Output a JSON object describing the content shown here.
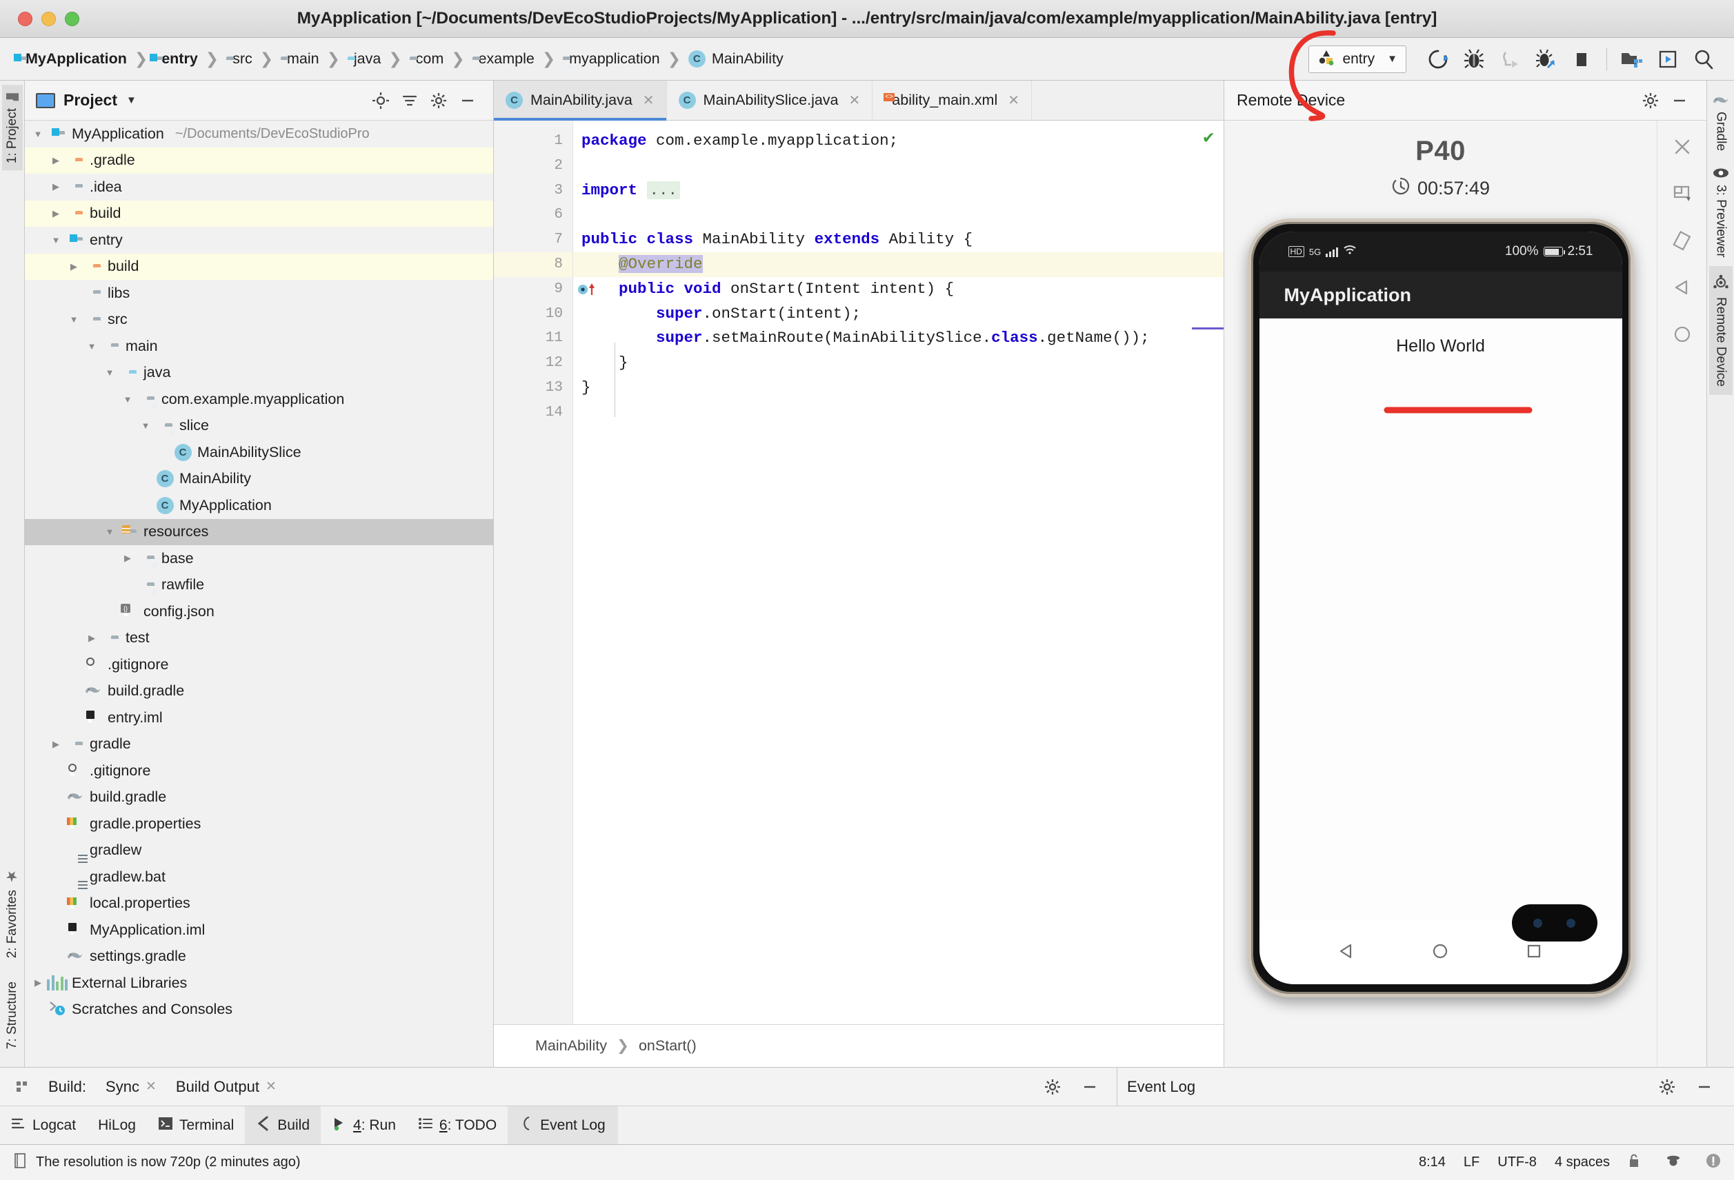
{
  "window": {
    "title": "MyApplication [~/Documents/DevEcoStudioProjects/MyApplication] - .../entry/src/main/java/com/example/myapplication/MainAbility.java [entry]"
  },
  "breadcrumbs": [
    {
      "label": "MyApplication",
      "icon": "module-folder-icon",
      "bold": true
    },
    {
      "label": "entry",
      "icon": "module-folder-icon",
      "bold": true
    },
    {
      "label": "src",
      "icon": "folder-icon",
      "bold": false
    },
    {
      "label": "main",
      "icon": "folder-icon",
      "bold": false
    },
    {
      "label": "java",
      "icon": "source-folder-icon",
      "bold": false
    },
    {
      "label": "com",
      "icon": "package-folder-icon",
      "bold": false
    },
    {
      "label": "example",
      "icon": "package-folder-icon",
      "bold": false
    },
    {
      "label": "myapplication",
      "icon": "package-folder-icon",
      "bold": false
    },
    {
      "label": "MainAbility",
      "icon": "java-class-icon",
      "bold": false
    }
  ],
  "toolbar": {
    "run_config_label": "entry",
    "buttons": [
      {
        "name": "rerun-button",
        "title": "Rerun"
      },
      {
        "name": "debug-button",
        "title": "Debug"
      },
      {
        "name": "attach-debugger-button",
        "title": "Attach Debugger"
      },
      {
        "name": "debug-ohos-button",
        "title": "Debug OHOS"
      },
      {
        "name": "stop-button",
        "title": "Stop"
      },
      {
        "name": "project-structure-button",
        "title": "Project Structure"
      },
      {
        "name": "previewer-button",
        "title": "Previewer"
      },
      {
        "name": "search-everywhere-button",
        "title": "Search Everywhere"
      }
    ]
  },
  "left_strip": {
    "top": "1: Project",
    "favorites": "2: Favorites",
    "structure": "7: Structure"
  },
  "project_panel": {
    "title": "Project",
    "tree": [
      {
        "label": "MyApplication",
        "sub": "~/Documents/DevEcoStudioPro",
        "depth": 0,
        "arrow": "down",
        "icon": "module-folder-icon",
        "style": "sel-root"
      },
      {
        "label": ".gradle",
        "sub": "",
        "depth": 1,
        "arrow": "right",
        "icon": "orange-folder-icon",
        "style": "yellow"
      },
      {
        "label": ".idea",
        "sub": "",
        "depth": 1,
        "arrow": "right",
        "icon": "folder-icon",
        "style": ""
      },
      {
        "label": "build",
        "sub": "",
        "depth": 1,
        "arrow": "right",
        "icon": "orange-folder-icon",
        "style": "yellow"
      },
      {
        "label": "entry",
        "sub": "",
        "depth": 1,
        "arrow": "down",
        "icon": "module-folder-icon",
        "style": ""
      },
      {
        "label": "build",
        "sub": "",
        "depth": 2,
        "arrow": "right",
        "icon": "orange-folder-icon",
        "style": "yellow"
      },
      {
        "label": "libs",
        "sub": "",
        "depth": 2,
        "arrow": "none",
        "icon": "folder-icon",
        "style": ""
      },
      {
        "label": "src",
        "sub": "",
        "depth": 2,
        "arrow": "down",
        "icon": "folder-icon",
        "style": ""
      },
      {
        "label": "main",
        "sub": "",
        "depth": 3,
        "arrow": "down",
        "icon": "folder-icon",
        "style": ""
      },
      {
        "label": "java",
        "sub": "",
        "depth": 4,
        "arrow": "down",
        "icon": "source-folder-icon",
        "style": ""
      },
      {
        "label": "com.example.myapplication",
        "sub": "",
        "depth": 5,
        "arrow": "down",
        "icon": "package-folder-icon",
        "style": ""
      },
      {
        "label": "slice",
        "sub": "",
        "depth": 6,
        "arrow": "down",
        "icon": "package-folder-icon",
        "style": ""
      },
      {
        "label": "MainAbilitySlice",
        "sub": "",
        "depth": 7,
        "arrow": "none",
        "icon": "java-class-icon",
        "style": ""
      },
      {
        "label": "MainAbility",
        "sub": "",
        "depth": 6,
        "arrow": "none",
        "icon": "java-class-icon",
        "style": ""
      },
      {
        "label": "MyApplication",
        "sub": "",
        "depth": 6,
        "arrow": "none",
        "icon": "java-class-icon",
        "style": ""
      },
      {
        "label": "resources",
        "sub": "",
        "depth": 4,
        "arrow": "down",
        "icon": "resource-folder-icon",
        "style": "sel"
      },
      {
        "label": "base",
        "sub": "",
        "depth": 5,
        "arrow": "right",
        "icon": "package-folder-icon",
        "style": ""
      },
      {
        "label": "rawfile",
        "sub": "",
        "depth": 5,
        "arrow": "none",
        "icon": "package-folder-icon",
        "style": ""
      },
      {
        "label": "config.json",
        "sub": "",
        "depth": 4,
        "arrow": "none",
        "icon": "json-file-icon",
        "style": ""
      },
      {
        "label": "test",
        "sub": "",
        "depth": 3,
        "arrow": "right",
        "icon": "folder-icon",
        "style": ""
      },
      {
        "label": ".gitignore",
        "sub": "",
        "depth": 2,
        "arrow": "none",
        "icon": "gitignore-file-icon",
        "style": ""
      },
      {
        "label": "build.gradle",
        "sub": "",
        "depth": 2,
        "arrow": "none",
        "icon": "gradle-file-icon",
        "style": ""
      },
      {
        "label": "entry.iml",
        "sub": "",
        "depth": 2,
        "arrow": "none",
        "icon": "iml-file-icon",
        "style": ""
      },
      {
        "label": "gradle",
        "sub": "",
        "depth": 1,
        "arrow": "right",
        "icon": "folder-icon",
        "style": ""
      },
      {
        "label": ".gitignore",
        "sub": "",
        "depth": 1,
        "arrow": "none",
        "icon": "gitignore-file-icon",
        "style": ""
      },
      {
        "label": "build.gradle",
        "sub": "",
        "depth": 1,
        "arrow": "none",
        "icon": "gradle-file-icon",
        "style": ""
      },
      {
        "label": "gradle.properties",
        "sub": "",
        "depth": 1,
        "arrow": "none",
        "icon": "properties-file-icon",
        "style": ""
      },
      {
        "label": "gradlew",
        "sub": "",
        "depth": 1,
        "arrow": "none",
        "icon": "script-file-icon",
        "style": ""
      },
      {
        "label": "gradlew.bat",
        "sub": "",
        "depth": 1,
        "arrow": "none",
        "icon": "script-file-icon",
        "style": ""
      },
      {
        "label": "local.properties",
        "sub": "",
        "depth": 1,
        "arrow": "none",
        "icon": "properties-file-icon",
        "style": ""
      },
      {
        "label": "MyApplication.iml",
        "sub": "",
        "depth": 1,
        "arrow": "none",
        "icon": "iml-file-icon",
        "style": ""
      },
      {
        "label": "settings.gradle",
        "sub": "",
        "depth": 1,
        "arrow": "none",
        "icon": "gradle-file-icon",
        "style": ""
      },
      {
        "label": "External Libraries",
        "sub": "",
        "depth": 0,
        "arrow": "right",
        "icon": "external-libraries-icon",
        "style": ""
      },
      {
        "label": "Scratches and Consoles",
        "sub": "",
        "depth": 0,
        "arrow": "none",
        "icon": "scratches-icon",
        "style": ""
      }
    ]
  },
  "editor": {
    "tabs": [
      {
        "label": "MainAbility.java",
        "icon": "java-class-icon",
        "active": true
      },
      {
        "label": "MainAbilitySlice.java",
        "icon": "java-class-icon",
        "active": false
      },
      {
        "label": "ability_main.xml",
        "icon": "xml-file-icon",
        "active": false
      }
    ],
    "line_numbers": [
      "1",
      "2",
      "3",
      "6",
      "7",
      "8",
      "9",
      "10",
      "11",
      "12",
      "13",
      "14"
    ],
    "lines": [
      {
        "n": "1",
        "segments": [
          {
            "t": "package ",
            "c": "kw"
          },
          {
            "t": "com.example.myapplication;",
            "c": "plain"
          }
        ]
      },
      {
        "n": "2",
        "segments": []
      },
      {
        "n": "3",
        "segments": [
          {
            "t": "import ",
            "c": "kw"
          },
          {
            "t": "...",
            "c": "fold"
          }
        ]
      },
      {
        "n": "6",
        "segments": []
      },
      {
        "n": "7",
        "segments": [
          {
            "t": "public class ",
            "c": "kw"
          },
          {
            "t": "MainAbility ",
            "c": "plain"
          },
          {
            "t": "extends ",
            "c": "kw"
          },
          {
            "t": "Ability {",
            "c": "plain"
          }
        ]
      },
      {
        "n": "8",
        "segments": [
          {
            "t": "    ",
            "c": "plain"
          },
          {
            "t": "@Override",
            "c": "ann-sel"
          }
        ]
      },
      {
        "n": "9",
        "segments": [
          {
            "t": "    ",
            "c": "plain"
          },
          {
            "t": "public void ",
            "c": "kw"
          },
          {
            "t": "onStart(Intent intent) {",
            "c": "plain"
          }
        ]
      },
      {
        "n": "10",
        "segments": [
          {
            "t": "        ",
            "c": "plain"
          },
          {
            "t": "super",
            "c": "kw"
          },
          {
            "t": ".onStart(intent);",
            "c": "plain"
          }
        ]
      },
      {
        "n": "11",
        "segments": [
          {
            "t": "        ",
            "c": "plain"
          },
          {
            "t": "super",
            "c": "kw"
          },
          {
            "t": ".setMainRoute(MainAbilitySlice.",
            "c": "plain"
          },
          {
            "t": "class",
            "c": "kw"
          },
          {
            "t": ".getName());",
            "c": "plain"
          }
        ]
      },
      {
        "n": "12",
        "segments": [
          {
            "t": "    }",
            "c": "plain"
          }
        ]
      },
      {
        "n": "13",
        "segments": [
          {
            "t": "}",
            "c": "plain"
          }
        ]
      },
      {
        "n": "14",
        "segments": []
      }
    ],
    "breadcrumb": [
      "MainAbility",
      "onStart()"
    ]
  },
  "device_panel": {
    "title": "Remote Device",
    "device_name": "P40",
    "timer": "00:57:49",
    "phone": {
      "status_bar": {
        "hd": "HD",
        "net": "5G",
        "battery_pct": "100%",
        "clock": "2:51"
      },
      "app_title": "MyApplication",
      "body_text": "Hello World"
    },
    "tools": [
      "close-icon",
      "resize-icon",
      "rotate-icon",
      "back-icon",
      "home-icon"
    ]
  },
  "right_strip": [
    {
      "label": "Gradle",
      "icon": "gradle-icon",
      "active": false
    },
    {
      "label": "3: Previewer",
      "icon": "eye-icon",
      "active": false
    },
    {
      "label": "Remote Device",
      "icon": "remote-device-icon",
      "active": true
    }
  ],
  "bottom": {
    "build_label": "Build:",
    "build_tabs": [
      "Sync",
      "Build Output"
    ],
    "event_log_header": "Event Log",
    "tool_window_tabs": [
      {
        "label": "Logcat",
        "icon": "logcat-icon",
        "active": false,
        "num": ""
      },
      {
        "label": "HiLog",
        "icon": "",
        "active": false,
        "num": ""
      },
      {
        "label": "Terminal",
        "icon": "terminal-icon",
        "active": false,
        "num": ""
      },
      {
        "label": "Build",
        "icon": "build-icon",
        "active": true,
        "num": ""
      },
      {
        "label": "4: Run",
        "icon": "run-icon",
        "active": false,
        "num": "4"
      },
      {
        "label": "6: TODO",
        "icon": "todo-icon",
        "active": false,
        "num": "6"
      }
    ],
    "event_log_tab": "Event Log",
    "status_message": "The resolution is now 720p (2 minutes ago)",
    "status_right": [
      "8:14",
      "LF",
      "UTF-8",
      "4 spaces"
    ]
  },
  "annotations": {
    "color": "#e8322a",
    "marks": [
      "circle-around-rerun-button",
      "underline-under-hello-world"
    ]
  }
}
